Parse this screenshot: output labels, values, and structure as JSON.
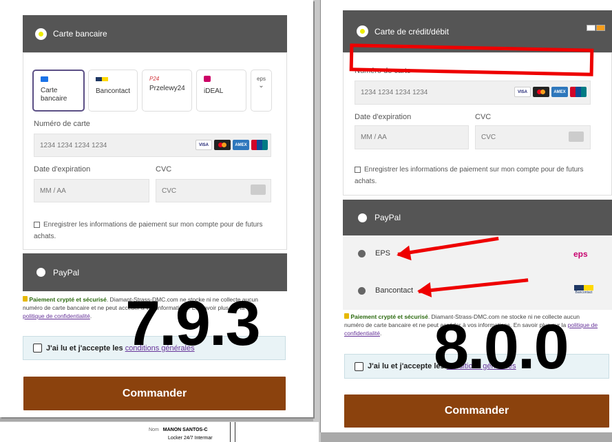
{
  "left": {
    "header": "Carte bancaire",
    "methods": [
      "Carte bancaire",
      "Bancontact",
      "Przelewy24",
      "iDEAL"
    ],
    "more_label": "eps",
    "card_number_label": "Numéro de carte",
    "card_number_placeholder": "1234 1234 1234 1234",
    "expiry_label": "Date d'expiration",
    "expiry_placeholder": "MM / AA",
    "cvc_label": "CVC",
    "cvc_placeholder": "CVC",
    "save_label": "Enregistrer les informations de paiement sur mon compte pour de futurs achats.",
    "paypal_label": "PayPal",
    "secure_bold": "Paiement crypté et sécurisé",
    "secure_text": ". Diamant-Strass-DMC.com ne stocke ni ne collecte aucun numéro de carte bancaire et ne peut accéder à vos informations. En savoir plus sur la",
    "privacy_link": "politique de confidentialité",
    "terms_text": "J'ai lu et j'accepte les",
    "terms_link": "conditions générales",
    "order_button": "Commander",
    "version": "7.9.3"
  },
  "right": {
    "header": "Carte de crédit/débit",
    "card_number_label": "Numéro de carte",
    "card_number_placeholder": "1234 1234 1234 1234",
    "expiry_label": "Date d'expiration",
    "expiry_placeholder": "MM / AA",
    "cvc_label": "CVC",
    "cvc_placeholder": "CVC",
    "save_label": "Enregistrer les informations de paiement sur mon compte pour de futurs achats.",
    "paypal_label": "PayPal",
    "eps_label": "EPS",
    "eps_logo": "eps",
    "bancontact_label": "Bancontact",
    "bancontact_logo": "Bancontact",
    "secure_bold": "Paiement crypté et sécurisé",
    "secure_text": ". Diamant-Strass-DMC.com ne stocke ni ne collecte aucun numéro de carte bancaire et ne peut accéder à vos informations. En savoir plus sur la",
    "privacy_link": "politique de confidentialité",
    "terms_text": "J'ai lu et j'accepte les",
    "terms_link": "conditions générales",
    "order_button": "Commander",
    "version": "8.0.0"
  },
  "card_brands": [
    "VISA",
    "MC",
    "AMEX",
    "UnionPay"
  ],
  "paper": {
    "nom_label": "Nom",
    "nom_value": "MANON SANTOS-C",
    "line2": "Locker 24/7 Intermar"
  },
  "colors": {
    "header": "#555555",
    "button": "#8b420d",
    "annotation": "#ee0000",
    "link": "#663399"
  }
}
